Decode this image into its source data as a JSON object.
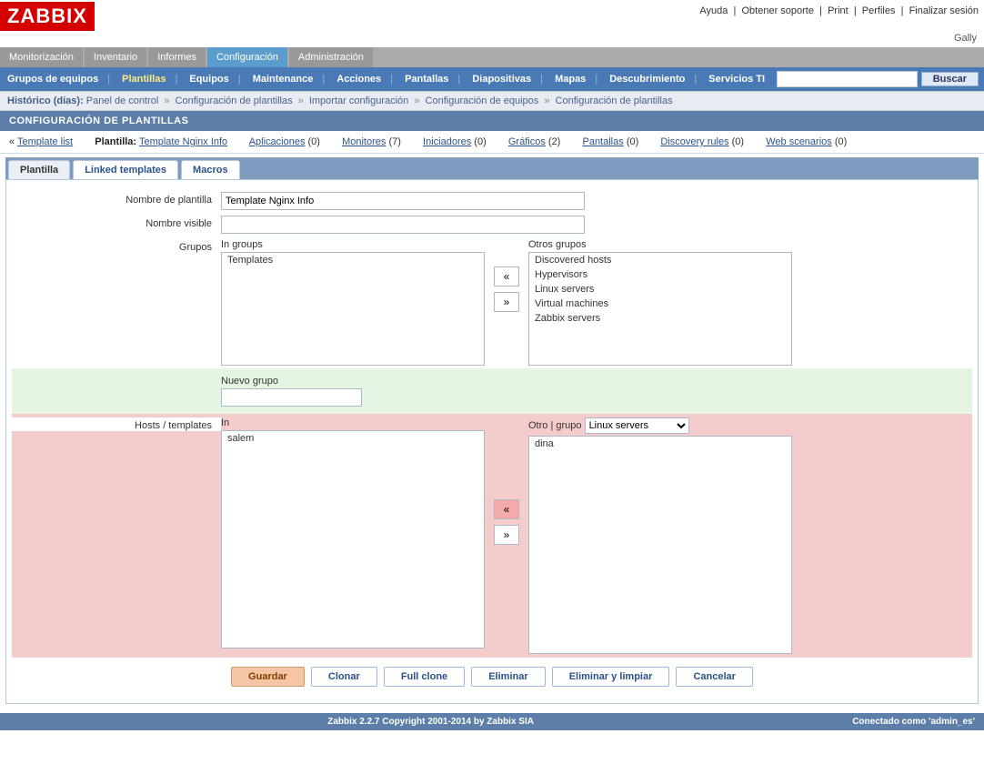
{
  "logo": "ZABBIX",
  "top_links": {
    "help": "Ayuda",
    "support": "Obtener soporte",
    "print": "Print",
    "profile": "Perfiles",
    "logout": "Finalizar sesión"
  },
  "user": "Gally",
  "main_nav": {
    "monitoring": "Monitorización",
    "inventory": "Inventario",
    "reports": "Informes",
    "config": "Configuración",
    "admin": "Administración"
  },
  "sub_nav": {
    "hostgroups": "Grupos de equipos",
    "templates": "Plantillas",
    "hosts": "Equipos",
    "maintenance": "Maintenance",
    "actions": "Acciones",
    "screens": "Pantallas",
    "slides": "Diapositivas",
    "maps": "Mapas",
    "discovery": "Descubrimiento",
    "itservices": "Servicios TI"
  },
  "search_btn": "Buscar",
  "history_label": "Histórico (días):",
  "breadcrumbs": [
    "Panel de control",
    "Configuración de plantillas",
    "Importar configuración",
    "Configuración de equipos",
    "Configuración de plantillas"
  ],
  "page_title": "CONFIGURACIÓN DE PLANTILLAS",
  "header": {
    "back": "«",
    "list": "Template list",
    "tpl_label": "Plantilla:",
    "tpl_name": "Template Nginx Info",
    "apps": "Aplicaciones",
    "apps_n": "(0)",
    "items": "Monitores",
    "items_n": "(7)",
    "triggers": "Iniciadores",
    "triggers_n": "(0)",
    "graphs": "Gráficos",
    "graphs_n": "(2)",
    "screens": "Pantallas",
    "screens_n": "(0)",
    "discovery": "Discovery rules",
    "discovery_n": "(0)",
    "web": "Web scenarios",
    "web_n": "(0)"
  },
  "tabs": {
    "tpl": "Plantilla",
    "linked": "Linked templates",
    "macros": "Macros"
  },
  "form": {
    "name_label": "Nombre de plantilla",
    "name_value": "Template Nginx Info",
    "visible_label": "Nombre visible",
    "visible_value": "",
    "groups_label": "Grupos",
    "in_groups": "In groups",
    "other_groups": "Otros grupos",
    "groups_in": [
      "Templates"
    ],
    "groups_other": [
      "Discovered hosts",
      "Hypervisors",
      "Linux servers",
      "Virtual machines",
      "Zabbix servers"
    ],
    "new_group": "Nuevo grupo",
    "hosts_label": "Hosts / templates",
    "hosts_in": "In",
    "hosts_other": "Otro | grupo",
    "hosts_group_sel": "Linux servers",
    "hosts_in_list": [
      "salem"
    ],
    "hosts_other_list": [
      "dina"
    ],
    "left": "«",
    "right": "»"
  },
  "buttons": {
    "save": "Guardar",
    "clone": "Clonar",
    "full_clone": "Full clone",
    "delete": "Eliminar",
    "delete_clear": "Eliminar y limpiar",
    "cancel": "Cancelar"
  },
  "footer": {
    "copyright": "Zabbix 2.2.7 Copyright 2001-2014 by Zabbix SIA",
    "connected": "Conectado como 'admin_es'"
  }
}
